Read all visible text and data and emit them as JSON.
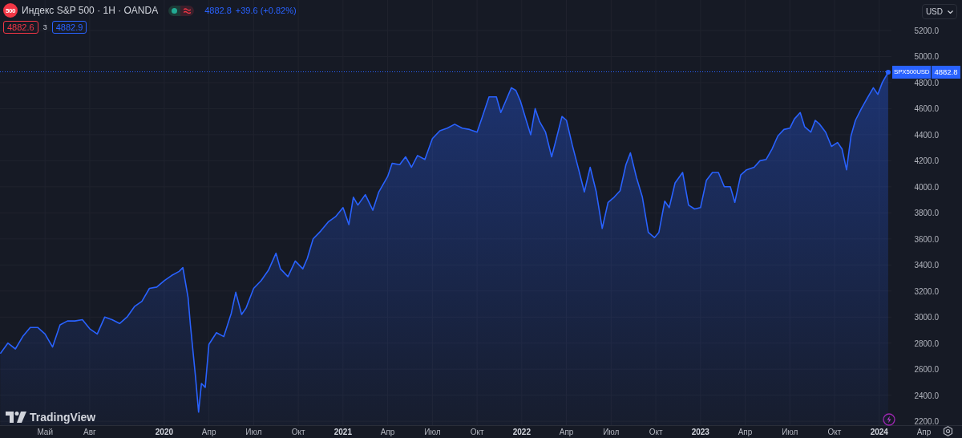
{
  "legend": {
    "logo_text": "500",
    "title": "Индекс S&P 500 · 1H · OANDA",
    "price": "4882.8",
    "change": "+39.6 (+0.82%)",
    "bid": "4882.6",
    "spread": "3",
    "ask": "4882.9"
  },
  "currency": {
    "label": "USD"
  },
  "price_tag": {
    "value": "4882.8"
  },
  "brand": "TradingView",
  "chart_data": {
    "type": "area",
    "grid": true,
    "ref_lines": [
      {
        "axis": "y",
        "value": 4882.8
      }
    ],
    "xlim": [
      2019.081,
      2024.463
    ],
    "ylim": [
      2170,
      5434
    ],
    "yticks": [
      {
        "value": 2200,
        "label": "2200.0"
      },
      {
        "value": 2400,
        "label": "2400.0"
      },
      {
        "value": 2600,
        "label": "2600.0"
      },
      {
        "value": 2800,
        "label": "2800.0"
      },
      {
        "value": 3000,
        "label": "3000.0"
      },
      {
        "value": 3200,
        "label": "3200.0"
      },
      {
        "value": 3400,
        "label": "3400.0"
      },
      {
        "value": 3600,
        "label": "3600.0"
      },
      {
        "value": 3800,
        "label": "3800.0"
      },
      {
        "value": 4000,
        "label": "4000.0"
      },
      {
        "value": 4200,
        "label": "4200.0"
      },
      {
        "value": 4400,
        "label": "4400.0"
      },
      {
        "value": 4600,
        "label": "4600.0"
      },
      {
        "value": 4800,
        "label": "4800.0"
      },
      {
        "value": 5000,
        "label": "5000.0"
      },
      {
        "value": 5200,
        "label": "5200.0"
      }
    ],
    "xticks": [
      {
        "value": 2019.333,
        "label": "Май"
      },
      {
        "value": 2019.583,
        "label": "Авг"
      },
      2020,
      {
        "value": 2020.25,
        "label": "Апр"
      },
      {
        "value": 2020.5,
        "label": "Июл"
      },
      {
        "value": 2020.75,
        "label": "Окт"
      },
      2021,
      {
        "value": 2021.25,
        "label": "Апр"
      },
      {
        "value": 2021.5,
        "label": "Июл"
      },
      {
        "value": 2021.75,
        "label": "Окт"
      },
      2022,
      {
        "value": 2022.25,
        "label": "Апр"
      },
      {
        "value": 2022.5,
        "label": "Июл"
      },
      {
        "value": 2022.75,
        "label": "Окт"
      },
      2023,
      {
        "value": 2023.25,
        "label": "Апр"
      },
      {
        "value": 2023.5,
        "label": "Июл"
      },
      {
        "value": 2023.75,
        "label": "Окт"
      },
      2024,
      {
        "value": 2024.25,
        "label": "Апр"
      }
    ],
    "x": [
      2019.083,
      2019.125,
      2019.167,
      2019.208,
      2019.25,
      2019.292,
      2019.333,
      2019.375,
      2019.417,
      2019.458,
      2019.5,
      2019.542,
      2019.583,
      2019.625,
      2019.667,
      2019.708,
      2019.75,
      2019.792,
      2019.833,
      2019.875,
      2019.917,
      2019.958,
      2020,
      2020.042,
      2020.083,
      2020.104,
      2020.133,
      2020.146,
      2020.175,
      2020.192,
      2020.208,
      2020.229,
      2020.25,
      2020.292,
      2020.333,
      2020.375,
      2020.4,
      2020.433,
      2020.458,
      2020.5,
      2020.542,
      2020.583,
      2020.625,
      2020.65,
      2020.692,
      2020.733,
      2020.775,
      2020.8,
      2020.833,
      2020.875,
      2020.917,
      2020.958,
      2021,
      2021.033,
      2021.058,
      2021.083,
      2021.125,
      2021.167,
      2021.2,
      2021.25,
      2021.275,
      2021.317,
      2021.35,
      2021.383,
      2021.417,
      2021.458,
      2021.5,
      2021.542,
      2021.583,
      2021.625,
      2021.667,
      2021.708,
      2021.75,
      2021.775,
      2021.817,
      2021.858,
      2021.883,
      2021.908,
      2021.942,
      2021.967,
      2021.992,
      2022.025,
      2022.05,
      2022.075,
      2022.1,
      2022.133,
      2022.167,
      2022.192,
      2022.225,
      2022.25,
      2022.283,
      2022.317,
      2022.35,
      2022.383,
      2022.417,
      2022.45,
      2022.483,
      2022.517,
      2022.55,
      2022.583,
      2022.608,
      2022.642,
      2022.675,
      2022.708,
      2022.742,
      2022.767,
      2022.8,
      2022.825,
      2022.858,
      2022.9,
      2022.933,
      2022.967,
      2023,
      2023.033,
      2023.067,
      2023.1,
      2023.133,
      2023.167,
      2023.192,
      2023.225,
      2023.258,
      2023.3,
      2023.333,
      2023.367,
      2023.4,
      2023.433,
      2023.467,
      2023.5,
      2023.525,
      2023.558,
      2023.583,
      2023.617,
      2023.642,
      2023.667,
      2023.7,
      2023.733,
      2023.767,
      2023.792,
      2023.817,
      2023.842,
      2023.867,
      2023.9,
      2023.933,
      2023.967,
      2023.992,
      2024.017,
      2024.05
    ],
    "series": [
      {
        "name": "SPX500USD",
        "color": "#2962ff",
        "values": [
          2720,
          2800,
          2755,
          2850,
          2920,
          2920,
          2870,
          2770,
          2940,
          2970,
          2970,
          2980,
          2910,
          2870,
          3000,
          2980,
          2950,
          3000,
          3080,
          3120,
          3220,
          3230,
          3280,
          3320,
          3350,
          3380,
          3150,
          2940,
          2540,
          2270,
          2490,
          2460,
          2790,
          2880,
          2850,
          3030,
          3190,
          3020,
          3070,
          3220,
          3280,
          3360,
          3490,
          3370,
          3310,
          3430,
          3370,
          3450,
          3600,
          3660,
          3730,
          3770,
          3840,
          3710,
          3920,
          3860,
          3940,
          3820,
          3960,
          4080,
          4180,
          4170,
          4230,
          4150,
          4240,
          4210,
          4370,
          4430,
          4450,
          4480,
          4450,
          4440,
          4420,
          4520,
          4690,
          4690,
          4570,
          4650,
          4760,
          4740,
          4660,
          4510,
          4400,
          4600,
          4500,
          4420,
          4230,
          4360,
          4540,
          4510,
          4320,
          4140,
          3960,
          4150,
          3960,
          3680,
          3880,
          3920,
          3970,
          4170,
          4260,
          4070,
          3920,
          3650,
          3610,
          3650,
          3890,
          3840,
          4030,
          4110,
          3860,
          3830,
          3840,
          4050,
          4110,
          4110,
          4000,
          4000,
          3880,
          4090,
          4130,
          4150,
          4200,
          4210,
          4290,
          4390,
          4440,
          4450,
          4520,
          4570,
          4460,
          4420,
          4510,
          4480,
          4420,
          4310,
          4340,
          4290,
          4130,
          4390,
          4510,
          4600,
          4680,
          4760,
          4710,
          4800,
          4880
        ]
      }
    ]
  }
}
